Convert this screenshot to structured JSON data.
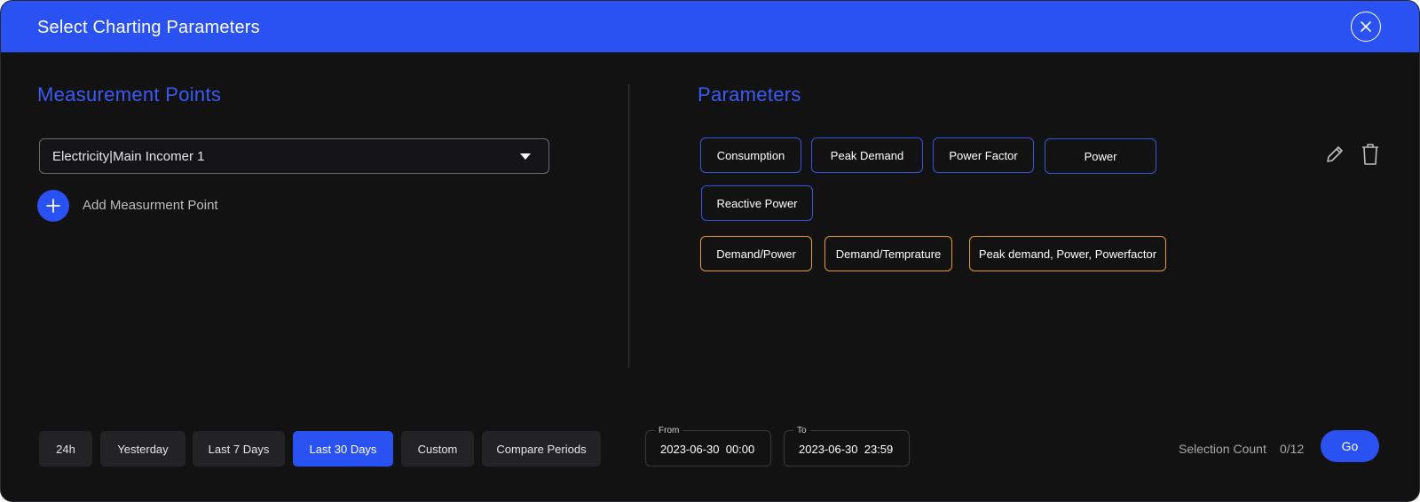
{
  "header": {
    "title": "Select Charting Parameters",
    "close_icon": "close-icon"
  },
  "measurement": {
    "title": "Measurement Points",
    "selected_point": "Electricity|Main Incomer 1",
    "add_label": "Add Measurment Point"
  },
  "parameters": {
    "title": "Parameters",
    "chips": [
      "Consumption",
      "Peak Demand",
      "Power Factor",
      "Power",
      "Reactive Power"
    ],
    "preset_chips": [
      "Demand/Power",
      "Demand/Temprature",
      "Peak demand, Power, Powerfactor"
    ],
    "actions": [
      "pencil-icon",
      "trash-icon"
    ]
  },
  "time_range": {
    "options": [
      "24h",
      "Yesterday",
      "Last 7 Days",
      "Last 30 Days",
      "Custom",
      "Compare Periods"
    ],
    "active": "Last 30 Days"
  },
  "dates": {
    "from_label": "From",
    "from_value": "2023-06-30  00:00",
    "to_label": "To",
    "to_value": "2023-06-30  23:59"
  },
  "footer": {
    "selection_label": "Selection Count",
    "selection_count": "0/12",
    "go_label": "Go"
  },
  "colors": {
    "accent": "#2a52f3",
    "title_blue": "#3b5bf5",
    "preset_border": "#e89a2c",
    "background": "#121213"
  }
}
